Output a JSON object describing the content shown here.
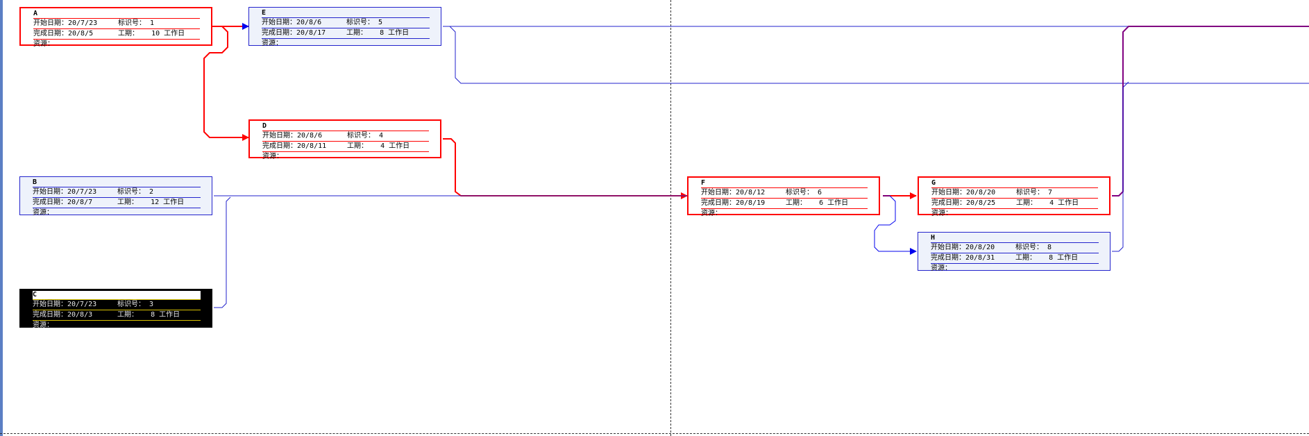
{
  "labels": {
    "start": "开始日期：",
    "finish": "完成日期：",
    "id": "标识号：",
    "duration": "工期：",
    "resource": "资源："
  },
  "colors": {
    "critical": "#ff0000",
    "normal": "#2222cc",
    "summary": "#800080"
  },
  "nodes": [
    {
      "key": "A",
      "title": "A",
      "start": "20/7/23",
      "finish": "20/8/5",
      "id": "1",
      "duration": "10 工作日",
      "critical": true
    },
    {
      "key": "E",
      "title": "E",
      "start": "20/8/6",
      "finish": "20/8/17",
      "id": "5",
      "duration": "8 工作日",
      "critical": false
    },
    {
      "key": "D",
      "title": "D",
      "start": "20/8/6",
      "finish": "20/8/11",
      "id": "4",
      "duration": "4 工作日",
      "critical": true
    },
    {
      "key": "B",
      "title": "B",
      "start": "20/7/23",
      "finish": "20/8/7",
      "id": "2",
      "duration": "12 工作日",
      "critical": false
    },
    {
      "key": "C",
      "title": "C",
      "start": "20/7/23",
      "finish": "20/8/3",
      "id": "3",
      "duration": "8 工作日",
      "critical": false,
      "selected": true
    },
    {
      "key": "F",
      "title": "F",
      "start": "20/8/12",
      "finish": "20/8/19",
      "id": "6",
      "duration": "6 工作日",
      "critical": true
    },
    {
      "key": "G",
      "title": "G",
      "start": "20/8/20",
      "finish": "20/8/25",
      "id": "7",
      "duration": "4 工作日",
      "critical": true
    },
    {
      "key": "H",
      "title": "H",
      "start": "20/8/20",
      "finish": "20/8/31",
      "id": "8",
      "duration": "8 工作日",
      "critical": false
    }
  ]
}
